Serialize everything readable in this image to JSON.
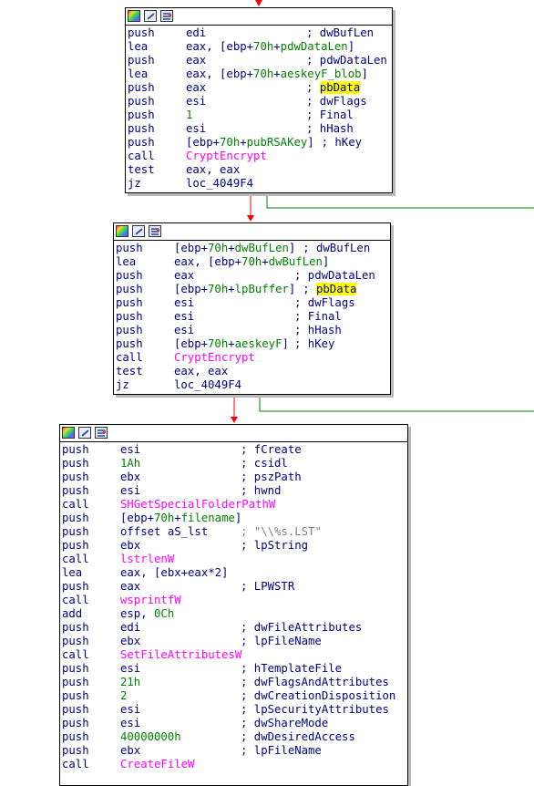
{
  "colors": {
    "background": "#ffffff",
    "text": "#000080",
    "api_call": "#ff00ff",
    "numeric_and_stack_var": "#008000",
    "highlight": "#ffff00",
    "false_edge": "#ff0000",
    "true_edge": "#008000",
    "shadow": "#b9b9b9"
  },
  "header_icons": [
    "graph-overview-icon",
    "edit-block-icon",
    "text-view-icon"
  ],
  "blocks": [
    {
      "lines": [
        {
          "mn": "push",
          "op": "edi",
          "cm": "; dwBufLen"
        },
        {
          "mn": "lea",
          "op": "eax, [ebp+70h+pdwDataLen]",
          "cm": ""
        },
        {
          "mn": "push",
          "op": "eax",
          "cm": "; pdwDataLen"
        },
        {
          "mn": "lea",
          "op": "eax, [ebp+70h+aeskeyF_blob]",
          "cm": ""
        },
        {
          "mn": "push",
          "op": "eax",
          "cm": "; pbData"
        },
        {
          "mn": "push",
          "op": "esi",
          "cm": "; dwFlags"
        },
        {
          "mn": "push",
          "op": "1",
          "cm": "; Final"
        },
        {
          "mn": "push",
          "op": "esi",
          "cm": "; hHash"
        },
        {
          "mn": "push",
          "op": "[ebp+70h+pubRSAKey]",
          "cm": "; hKey"
        },
        {
          "mn": "call",
          "op": "CryptEncrypt",
          "cm": ""
        },
        {
          "mn": "test",
          "op": "eax, eax",
          "cm": ""
        },
        {
          "mn": "jz",
          "op": "loc_4049F4",
          "cm": ""
        }
      ]
    },
    {
      "lines": [
        {
          "mn": "push",
          "op": "[ebp+70h+dwBufLen]",
          "cm": "; dwBufLen"
        },
        {
          "mn": "lea",
          "op": "eax, [ebp+70h+dwBufLen]",
          "cm": ""
        },
        {
          "mn": "push",
          "op": "eax",
          "cm": "; pdwDataLen"
        },
        {
          "mn": "push",
          "op": "[ebp+70h+lpBuffer]",
          "cm": "; pbData"
        },
        {
          "mn": "push",
          "op": "esi",
          "cm": "; dwFlags"
        },
        {
          "mn": "push",
          "op": "esi",
          "cm": "; Final"
        },
        {
          "mn": "push",
          "op": "esi",
          "cm": "; hHash"
        },
        {
          "mn": "push",
          "op": "[ebp+70h+aeskeyF]",
          "cm": "; hKey"
        },
        {
          "mn": "call",
          "op": "CryptEncrypt",
          "cm": ""
        },
        {
          "mn": "test",
          "op": "eax, eax",
          "cm": ""
        },
        {
          "mn": "jz",
          "op": "loc_4049F4",
          "cm": ""
        }
      ]
    },
    {
      "lines": [
        {
          "mn": "push",
          "op": "esi",
          "cm": "; fCreate"
        },
        {
          "mn": "push",
          "op": "1Ah",
          "cm": "; csidl"
        },
        {
          "mn": "push",
          "op": "ebx",
          "cm": "; pszPath"
        },
        {
          "mn": "push",
          "op": "esi",
          "cm": "; hwnd"
        },
        {
          "mn": "call",
          "op": "SHGetSpecialFolderPathW",
          "cm": ""
        },
        {
          "mn": "push",
          "op": "[ebp+70h+filename]",
          "cm": ""
        },
        {
          "mn": "push",
          "op": "offset aS_lst",
          "cm": "; \"\\\\%s.LST\""
        },
        {
          "mn": "push",
          "op": "ebx",
          "cm": "; lpString"
        },
        {
          "mn": "call",
          "op": "lstrlenW",
          "cm": ""
        },
        {
          "mn": "lea",
          "op": "eax, [ebx+eax*2]",
          "cm": ""
        },
        {
          "mn": "push",
          "op": "eax",
          "cm": "; LPWSTR"
        },
        {
          "mn": "call",
          "op": "wsprintfW",
          "cm": ""
        },
        {
          "mn": "add",
          "op": "esp, 0Ch",
          "cm": ""
        },
        {
          "mn": "push",
          "op": "edi",
          "cm": "; dwFileAttributes"
        },
        {
          "mn": "push",
          "op": "ebx",
          "cm": "; lpFileName"
        },
        {
          "mn": "call",
          "op": "SetFileAttributesW",
          "cm": ""
        },
        {
          "mn": "push",
          "op": "esi",
          "cm": "; hTemplateFile"
        },
        {
          "mn": "push",
          "op": "21h",
          "cm": "; dwFlagsAndAttributes"
        },
        {
          "mn": "push",
          "op": "2",
          "cm": "; dwCreationDisposition"
        },
        {
          "mn": "push",
          "op": "esi",
          "cm": "; lpSecurityAttributes"
        },
        {
          "mn": "push",
          "op": "esi",
          "cm": "; dwShareMode"
        },
        {
          "mn": "push",
          "op": "40000000h",
          "cm": "; dwDesiredAccess"
        },
        {
          "mn": "push",
          "op": "ebx",
          "cm": "; lpFileName"
        },
        {
          "mn": "call",
          "op": "CreateFileW",
          "cm": ""
        }
      ]
    }
  ]
}
